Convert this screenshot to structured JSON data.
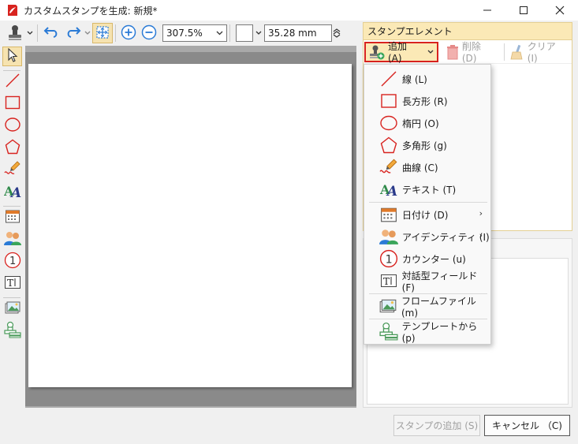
{
  "window": {
    "title": "カスタムスタンプを生成: 新規*",
    "controls": [
      "minimize",
      "maximize",
      "close"
    ]
  },
  "toolbar": {
    "zoom_value": "307.5%",
    "line_width_value": "35.28 mm"
  },
  "stamp_elements": {
    "header": "スタンプエレメント",
    "add_label": "追加 (A)",
    "delete_label": "削除 (D)",
    "clear_label": "クリア (I)"
  },
  "add_menu": {
    "items": [
      {
        "label": "線 (L)",
        "icon": "line-icon"
      },
      {
        "label": "長方形 (R)",
        "icon": "rectangle-icon"
      },
      {
        "label": "楕円 (O)",
        "icon": "ellipse-icon"
      },
      {
        "label": "多角形 (g)",
        "icon": "polygon-icon"
      },
      {
        "label": "曲線 (C)",
        "icon": "pencil-icon"
      },
      {
        "label": "テキスト (T)",
        "icon": "text-icon"
      },
      {
        "label": "日付け (D)",
        "icon": "calendar-icon",
        "submenu": true
      },
      {
        "label": "アイデンティティ (I)",
        "icon": "identity-icon",
        "submenu": true
      },
      {
        "label": "カウンター (u)",
        "icon": "counter-icon"
      },
      {
        "label": "対話型フィールド (F)",
        "icon": "text-field-icon"
      },
      {
        "label": "フロームファイル (m)",
        "icon": "image-icon"
      },
      {
        "label": "テンプレートから (p)",
        "icon": "template-icon"
      }
    ],
    "submenu_glyph": "›"
  },
  "footer": {
    "add_stamp_label": "スタンプの追加 (S)",
    "cancel_label": "キャンセル （C)"
  },
  "colors": {
    "accent_red": "#d8231f",
    "panel_header": "#fbe9b6",
    "icon_blue": "#2b7bd6"
  }
}
